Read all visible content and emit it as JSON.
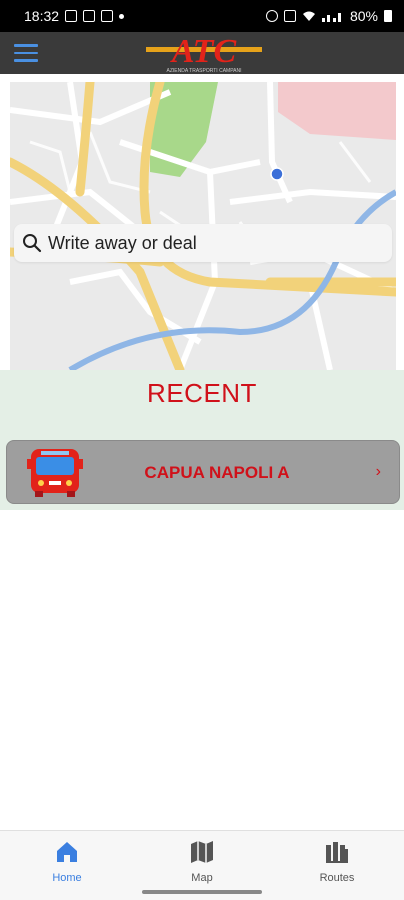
{
  "status_bar": {
    "time": "18:32",
    "battery": "80%"
  },
  "header": {
    "logo_text": "ATC",
    "logo_subtitle": "AZIENDA TRASPORTI CAMPANI",
    "brand_color": "#e2231a",
    "accent_color": "#4a90e2"
  },
  "search": {
    "placeholder": "Write away or deal"
  },
  "recent": {
    "title": "RECENT",
    "items": [
      {
        "label": "CAPUA NAPOLI A",
        "chevron": "›"
      }
    ]
  },
  "bottom_nav": {
    "items": [
      {
        "label": "Home",
        "icon": "home-icon",
        "active": true
      },
      {
        "label": "Map",
        "icon": "map-icon",
        "active": false
      },
      {
        "label": "Routes",
        "icon": "routes-icon",
        "active": false
      }
    ]
  }
}
